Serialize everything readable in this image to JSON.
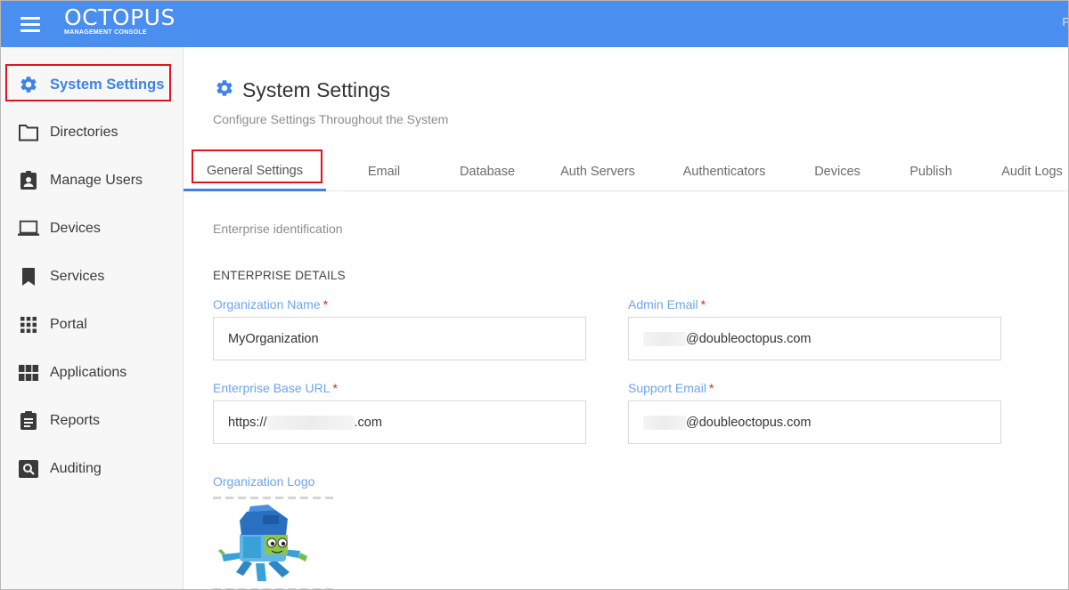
{
  "app": {
    "brand_title": "OCTOPUS",
    "brand_subtitle": "MANAGEMENT CONSOLE",
    "top_right_text": "P"
  },
  "sidebar": {
    "items": [
      {
        "label": "System Settings",
        "icon": "gear-icon",
        "active": true
      },
      {
        "label": "Directories",
        "icon": "folder-icon"
      },
      {
        "label": "Manage Users",
        "icon": "user-badge-icon"
      },
      {
        "label": "Devices",
        "icon": "laptop-icon"
      },
      {
        "label": "Services",
        "icon": "bookmark-icon"
      },
      {
        "label": "Portal",
        "icon": "grid-icon"
      },
      {
        "label": "Applications",
        "icon": "apps-icon"
      },
      {
        "label": "Reports",
        "icon": "clipboard-icon"
      },
      {
        "label": "Auditing",
        "icon": "search-box-icon"
      }
    ]
  },
  "page": {
    "title": "System Settings",
    "subtitle": "Configure Settings Throughout the System"
  },
  "tabs": [
    {
      "label": "General Settings",
      "active": true
    },
    {
      "label": "Email"
    },
    {
      "label": "Database"
    },
    {
      "label": "Auth Servers"
    },
    {
      "label": "Authenticators"
    },
    {
      "label": "Devices"
    },
    {
      "label": "Publish"
    },
    {
      "label": "Audit Logs"
    }
  ],
  "form": {
    "section_caption": "Enterprise identification",
    "section_heading": "ENTERPRISE DETAILS",
    "required_marker": "*",
    "org_name": {
      "label": "Organization Name",
      "value": "MyOrganization"
    },
    "admin_email": {
      "label": "Admin Email",
      "value_visible": "@doubleoctopus.com"
    },
    "base_url": {
      "label": "Enterprise Base URL",
      "value_prefix": "https://",
      "value_suffix": ".com"
    },
    "support_email": {
      "label": "Support Email",
      "value_visible": "@doubleoctopus.com"
    },
    "logo_label": "Organization Logo"
  },
  "colors": {
    "topbar": "#4a8ef0",
    "accent": "#3d82e8",
    "label_blue": "#6ea3ee",
    "highlight_red": "#e0141e",
    "required_red": "#e02020"
  }
}
